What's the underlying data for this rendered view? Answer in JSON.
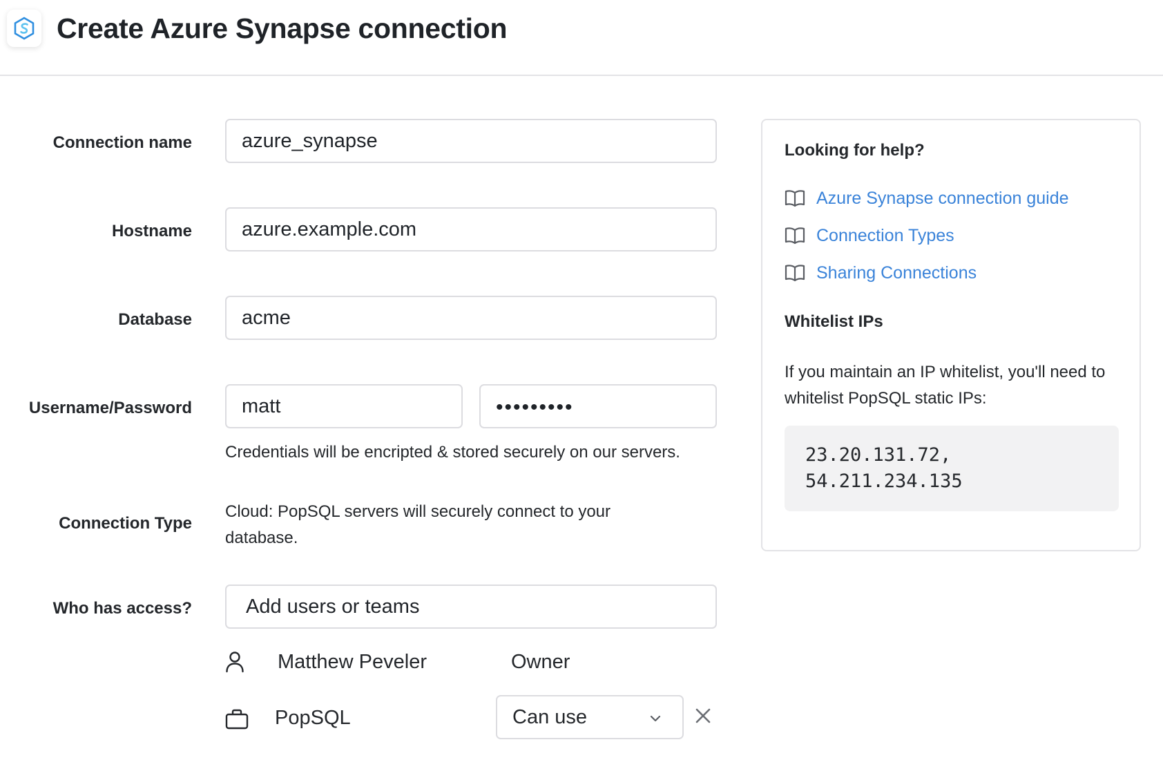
{
  "header": {
    "title": "Create Azure Synapse connection",
    "icon": "azure-synapse-icon"
  },
  "form": {
    "connection_name": {
      "label": "Connection name",
      "value": "azure_synapse"
    },
    "hostname": {
      "label": "Hostname",
      "value": "azure.example.com"
    },
    "database": {
      "label": "Database",
      "value": "acme"
    },
    "credentials": {
      "label": "Username/Password",
      "username": "matt",
      "password_mask": "•••••••••",
      "note": "Credentials will be encripted & stored securely on our servers."
    },
    "connection_type": {
      "label": "Connection Type",
      "description": "Cloud: PopSQL servers will securely connect to your database."
    },
    "access": {
      "label": "Who has access?",
      "placeholder": "Add users or teams",
      "members": [
        {
          "icon": "user-icon",
          "name": "Matthew Peveler",
          "role": "Owner"
        },
        {
          "icon": "briefcase-icon",
          "name": "PopSQL",
          "permission": "Can use"
        }
      ]
    }
  },
  "help": {
    "title": "Looking for help?",
    "links": [
      {
        "icon": "book-icon",
        "label": "Azure Synapse connection guide"
      },
      {
        "icon": "book-icon",
        "label": "Connection Types"
      },
      {
        "icon": "book-icon",
        "label": "Sharing Connections"
      }
    ],
    "whitelist": {
      "title": "Whitelist IPs",
      "description": "If you maintain an IP whitelist, you'll need to whitelist PopSQL static IPs:",
      "ips_line1": "23.20.131.72,",
      "ips_line2": "54.211.234.135"
    }
  },
  "colors": {
    "link": "#3a83d9",
    "border": "#dcdce0",
    "code_bg": "#f2f2f3",
    "brand_blue": "#2f8fe0"
  }
}
